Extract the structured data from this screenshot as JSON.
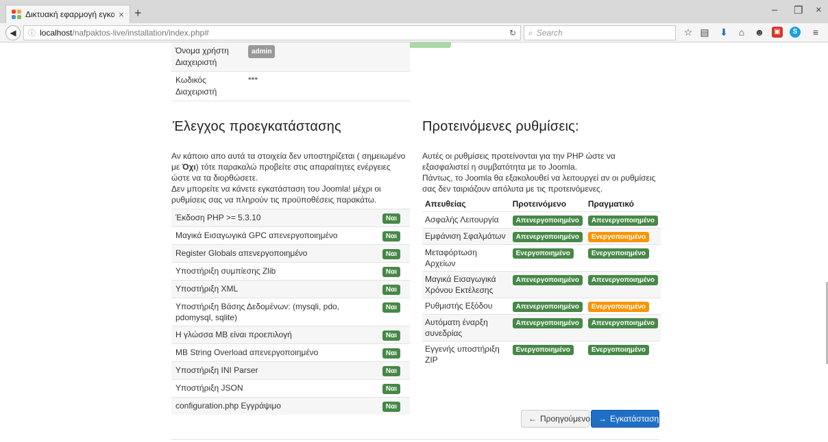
{
  "browser": {
    "tab_title": "Δικτυακή εφαρμογή εγκα...",
    "tab_close": "×",
    "new_tab": "+",
    "url_host": "localhost",
    "url_path": "/nafpaktos-live/installation/index.php#",
    "search_placeholder": "Search",
    "window_controls": [
      "–",
      "❐",
      "×"
    ],
    "toolbar_icons": [
      "star-icon",
      "reading-list-icon",
      "download-icon",
      "home-icon",
      "pocket-icon",
      "pdf-icon",
      "skype-icon",
      "menu-icon"
    ]
  },
  "admin": {
    "rows": [
      {
        "label": "Όνομα χρήστη Διαχειριστή",
        "value": "admin"
      },
      {
        "label": "Κωδικός Διαχειριστή",
        "value": "***"
      }
    ]
  },
  "precheck": {
    "title": "Έλεγχος προεγκατάστασης",
    "intro_1a": "Αν κάποιο απο αυτά τα στοιχεία δεν υποστηρίζεται ( σημειωμένο με ",
    "intro_1b": "Όχι",
    "intro_1c": ") τότε παρακαλώ προβείτε στις απαραίτητες ενέργειες ώστε να τα διορθώσετε.",
    "intro_2": "Δεν μπορείτε να κάνετε εγκατάσταση του Joomla! μέχρι οι ρυθμίσεις σας να πληρούν τις προϋποθέσεις παρακάτω.",
    "items": [
      {
        "label": "Έκδοση PHP >= 5.3.10",
        "status": "Ναι"
      },
      {
        "label": "Μαγικά Εισαγωγικά GPC απενεργοποιημένο",
        "status": "Ναι"
      },
      {
        "label": "Register Globals απενεργοποιημένο",
        "status": "Ναι"
      },
      {
        "label": "Υποστήριξη συμπίεσης Zlib",
        "status": "Ναι"
      },
      {
        "label": "Υποστήριξη XML",
        "status": "Ναι"
      },
      {
        "label": "Υποστήριξη Βάσης Δεδομένων: (mysqli, pdo, pdomysql, sqlite)",
        "status": "Ναι"
      },
      {
        "label": "Η γλώσσα MB είναι προεπιλογή",
        "status": "Ναι"
      },
      {
        "label": "MB String Overload απενεργοποιημένο",
        "status": "Ναι"
      },
      {
        "label": "Υποστήριξη INI Parser",
        "status": "Ναι"
      },
      {
        "label": "Υποστήριξη JSON",
        "status": "Ναι"
      },
      {
        "label": "configuration.php Εγγράψιμο",
        "status": "Ναι"
      }
    ]
  },
  "recommended": {
    "title": "Προτεινόμενες ρυθμίσεις:",
    "intro_1": "Αυτές οι ρυθμίσεις προτείνονται για την PHP ώστε να εξασφαλιστεί η συμβατότητα με το Joomla.",
    "intro_2": "Πάντως, το Joomla θα εξακολουθεί να λειτουργεί αν οι ρυθμίσεις σας δεν ταιριάζουν απόλυτα με τις προτεινόμενες.",
    "col_directive": "Απευθείας",
    "col_recommended": "Προτεινόμενο",
    "col_actual": "Πραγματικό",
    "rows": [
      {
        "directive": "Ασφαλής Λειτουργία",
        "recommended": "Απενεργοποιημένο",
        "actual": "Απενεργοποιημένο",
        "actual_state": "ok"
      },
      {
        "directive": "Εμφάνιση Σφαλμάτων",
        "recommended": "Απενεργοποιημένο",
        "actual": "Ενεργοποιημένο",
        "actual_state": "warn"
      },
      {
        "directive": "Μεταφόρτωση Αρχείων",
        "recommended": "Ενεργοποιημένο",
        "actual": "Ενεργοποιημένο",
        "actual_state": "ok"
      },
      {
        "directive": "Μαγικά Εισαγωγικά Χρόνου Εκτέλεσης",
        "recommended": "Απενεργοποιημένο",
        "actual": "Απενεργοποιημένο",
        "actual_state": "ok"
      },
      {
        "directive": "Ρυθμιστής Εξόδου",
        "recommended": "Απενεργοποιημένο",
        "actual": "Ενεργοποιημένο",
        "actual_state": "warn"
      },
      {
        "directive": "Αυτόματη έναρξη συνεδρίας",
        "recommended": "Απενεργοποιημένο",
        "actual": "Απενεργοποιημένο",
        "actual_state": "ok"
      },
      {
        "directive": "Εγγενής υποστήριξη ZIP",
        "recommended": "Ενεργοποιημένο",
        "actual": "Ενεργοποιημένο",
        "actual_state": "ok"
      }
    ]
  },
  "actions": {
    "prev_label": "Προηγούμενο",
    "install_label": "Εγκατάσταση"
  },
  "colors": {
    "badge_ok": "#468847",
    "badge_warn": "#f89406",
    "install_button": "#1f6fc5"
  }
}
